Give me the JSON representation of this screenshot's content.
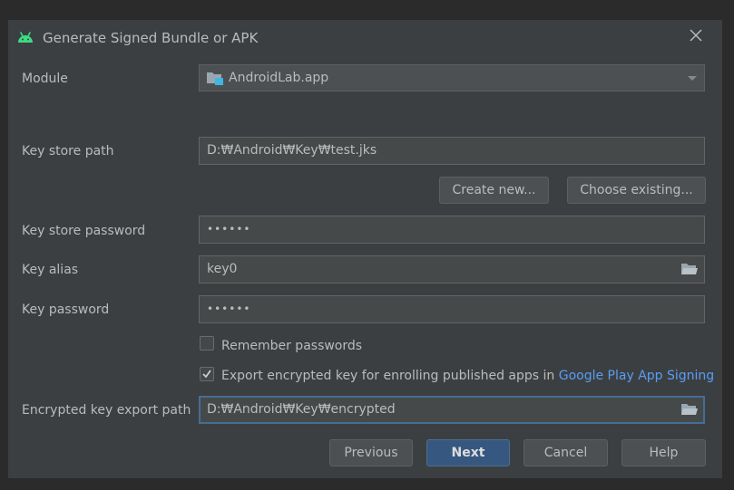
{
  "dialog": {
    "title": "Generate Signed Bundle or APK"
  },
  "module": {
    "label": "Module",
    "value": "AndroidLab.app"
  },
  "keystore": {
    "path_label": "Key store path",
    "path_value": "D:₩Android₩Key₩test.jks",
    "create_new_label": "Create new...",
    "choose_existing_label": "Choose existing...",
    "password_label": "Key store password",
    "password_value": "••••••"
  },
  "key": {
    "alias_label": "Key alias",
    "alias_value": "key0",
    "password_label": "Key password",
    "password_value": "••••••"
  },
  "options": {
    "remember_label": "Remember passwords",
    "remember_checked": false,
    "export_label": "Export encrypted key for enrolling published apps in",
    "export_link": "Google Play App Signing",
    "export_checked": true
  },
  "export_path": {
    "label": "Encrypted key export path",
    "value": "D:₩Android₩Key₩encrypted"
  },
  "footer": {
    "previous_label": "Previous",
    "next_label": "Next",
    "cancel_label": "Cancel",
    "help_label": "Help"
  },
  "icons": {
    "title": "android-icon",
    "close": "close-icon",
    "module": "module-folder-icon",
    "browse": "folder-icon",
    "check": "checkmark-icon",
    "dropdown": "chevron-down-icon"
  },
  "colors": {
    "background": "#3c3f41",
    "field": "#45494a",
    "primary_button": "#365880",
    "link": "#589df6",
    "android_green": "#3ddc84"
  }
}
